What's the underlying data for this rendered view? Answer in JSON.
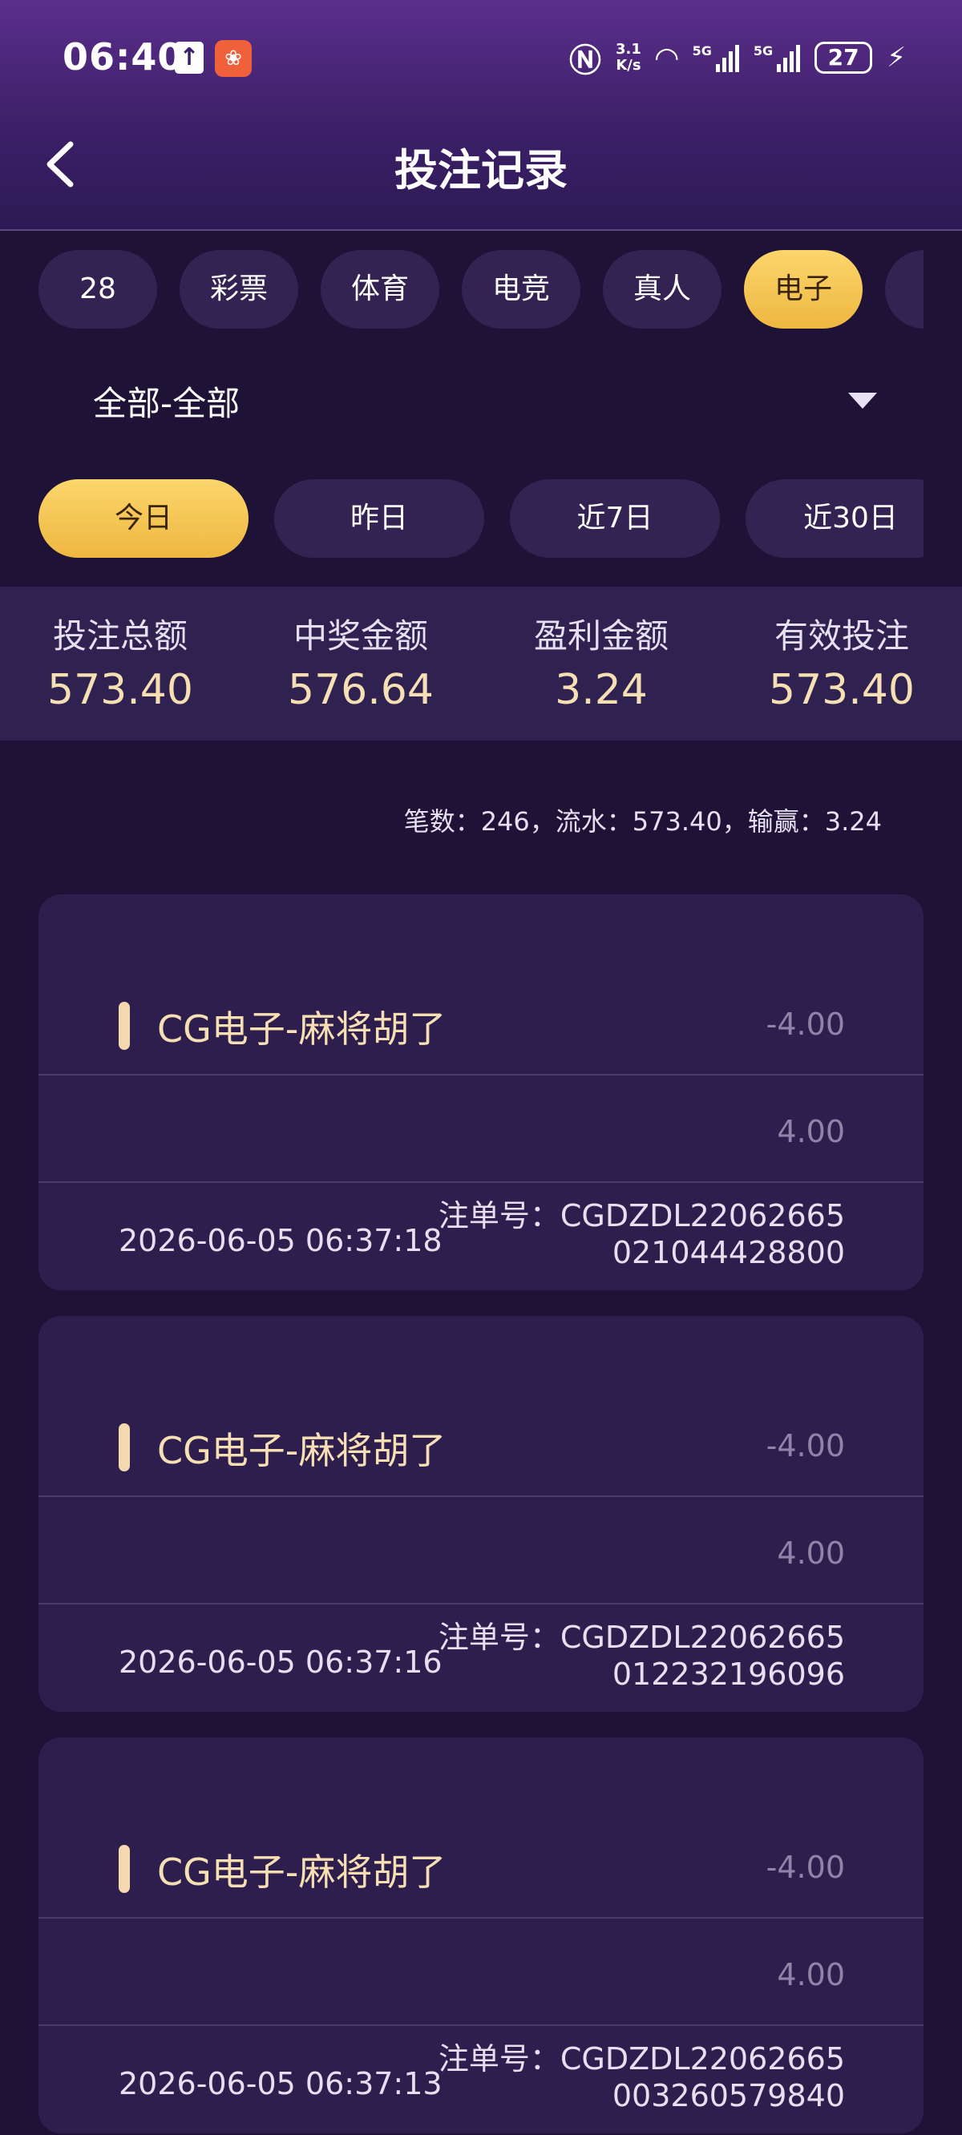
{
  "status_bar": {
    "time": "06:40",
    "net_speed": "3.1\nK/s",
    "signal_label_1": "5G",
    "signal_label_2": "5G",
    "battery": "27"
  },
  "header": {
    "title": "投注记录"
  },
  "categories": [
    {
      "label": "28",
      "active": false
    },
    {
      "label": "彩票",
      "active": false
    },
    {
      "label": "体育",
      "active": false
    },
    {
      "label": "电竞",
      "active": false
    },
    {
      "label": "真人",
      "active": false
    },
    {
      "label": "电子",
      "active": true
    }
  ],
  "filter": {
    "selected": "全部-全部"
  },
  "date_tabs": [
    {
      "label": "今日",
      "active": true
    },
    {
      "label": "昨日",
      "active": false
    },
    {
      "label": "近7日",
      "active": false
    },
    {
      "label": "近30日",
      "active": false
    }
  ],
  "stats": [
    {
      "label": "投注总额",
      "value": "573.40"
    },
    {
      "label": "中奖金额",
      "value": "576.64"
    },
    {
      "label": "盈利金额",
      "value": "3.24"
    },
    {
      "label": "有效投注",
      "value": "573.40"
    }
  ],
  "summary": "笔数：246，流水：573.40，输赢：3.24",
  "records": [
    {
      "game": "CG电子-麻将胡了",
      "result": "-4.00",
      "bet": "4.00",
      "time": "2026-06-05 06:37:18",
      "order": "注单号：CGDZDL22062665021044428800"
    },
    {
      "game": "CG电子-麻将胡了",
      "result": "-4.00",
      "bet": "4.00",
      "time": "2026-06-05 06:37:16",
      "order": "注单号：CGDZDL22062665012232196096"
    },
    {
      "game": "CG电子-麻将胡了",
      "result": "-4.00",
      "bet": "4.00",
      "time": "2026-06-05 06:37:13",
      "order": "注单号：CGDZDL22062665003260579840"
    }
  ],
  "colors": {
    "background": "#1f1237",
    "accent_gold": "#f5c852",
    "value_text": "#f7dfb4",
    "card_bg": "#2e1e4e"
  }
}
